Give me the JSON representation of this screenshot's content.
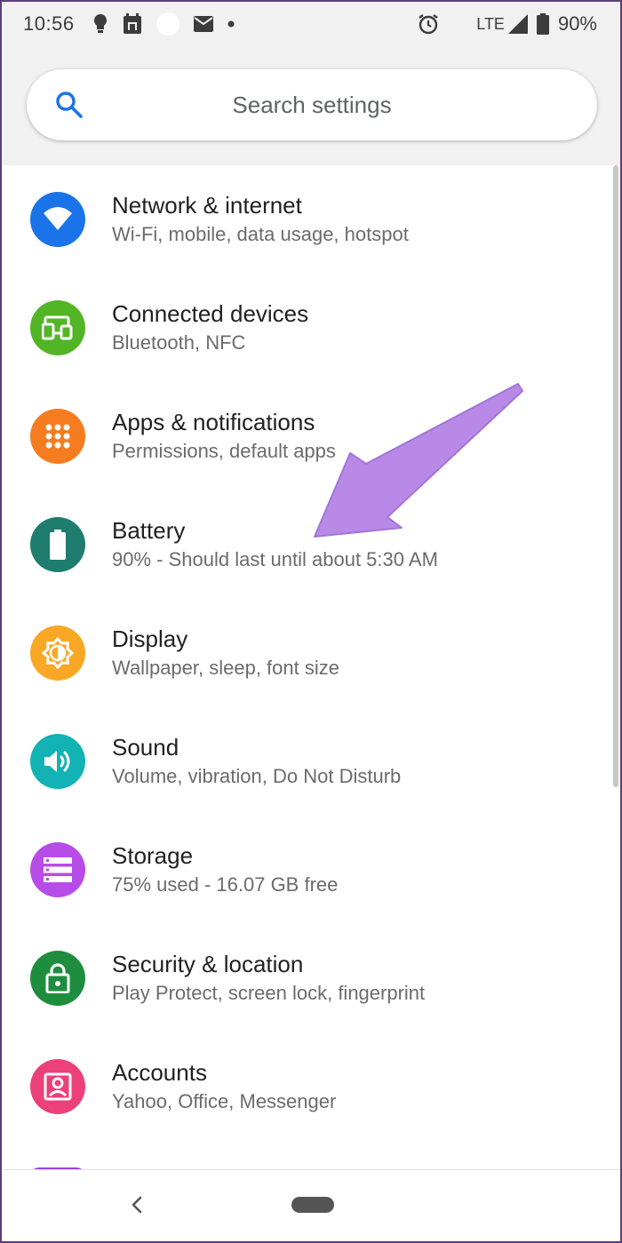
{
  "status_bar": {
    "time": "10:56",
    "network": "LTE",
    "battery_percent": "90%",
    "left_icons": [
      "bulb-icon",
      "calendar-icon",
      "circle-icon",
      "mail-icon",
      "dot-icon"
    ],
    "right_icons": [
      "alarm-icon",
      "signal-icon",
      "battery-icon"
    ]
  },
  "search": {
    "placeholder": "Search settings"
  },
  "settings": {
    "items": [
      {
        "title": "Network & internet",
        "subtitle": "Wi-Fi, mobile, data usage, hotspot",
        "icon": "wifi-icon",
        "color": "#1a73e8"
      },
      {
        "title": "Connected devices",
        "subtitle": "Bluetooth, NFC",
        "icon": "devices-icon",
        "color": "#52b526"
      },
      {
        "title": "Apps & notifications",
        "subtitle": "Permissions, default apps",
        "icon": "apps-icon",
        "color": "#f57c1f"
      },
      {
        "title": "Battery",
        "subtitle": "90% - Should last until about 5:30 AM",
        "icon": "battery-icon",
        "color": "#1e7d6f"
      },
      {
        "title": "Display",
        "subtitle": "Wallpaper, sleep, font size",
        "icon": "brightness-icon",
        "color": "#f9a825"
      },
      {
        "title": "Sound",
        "subtitle": "Volume, vibration, Do Not Disturb",
        "icon": "volume-icon",
        "color": "#12b2b5"
      },
      {
        "title": "Storage",
        "subtitle": "75% used - 16.07 GB free",
        "icon": "storage-icon",
        "color": "#b84ce8"
      },
      {
        "title": "Security & location",
        "subtitle": "Play Protect, screen lock, fingerprint",
        "icon": "lock-icon",
        "color": "#1e8e3e"
      },
      {
        "title": "Accounts",
        "subtitle": "Yahoo, Office, Messenger",
        "icon": "account-icon",
        "color": "#ec407a"
      }
    ]
  },
  "annotation": {
    "arrow_color": "#b889e6"
  },
  "nav": {
    "icons": [
      "back-icon",
      "home-pill"
    ]
  }
}
